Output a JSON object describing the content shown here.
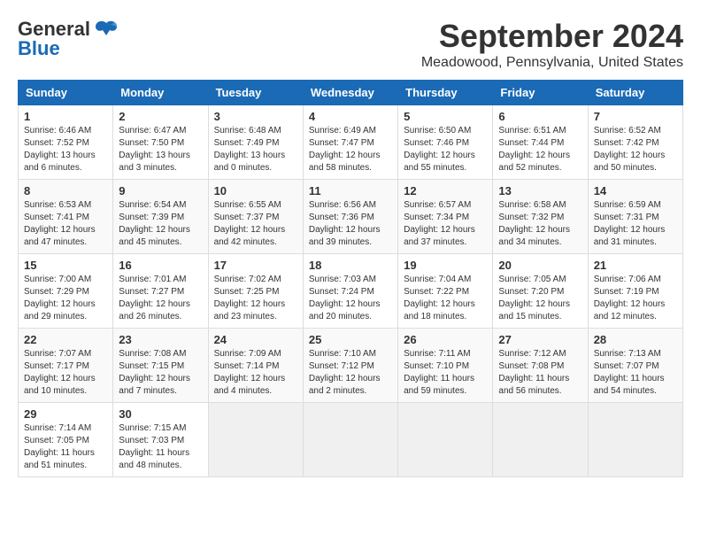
{
  "header": {
    "logo_general": "General",
    "logo_blue": "Blue",
    "month_title": "September 2024",
    "location": "Meadowood, Pennsylvania, United States"
  },
  "weekdays": [
    "Sunday",
    "Monday",
    "Tuesday",
    "Wednesday",
    "Thursday",
    "Friday",
    "Saturday"
  ],
  "weeks": [
    [
      {
        "day": "1",
        "sunrise": "6:46 AM",
        "sunset": "7:52 PM",
        "daylight": "13 hours and 6 minutes."
      },
      {
        "day": "2",
        "sunrise": "6:47 AM",
        "sunset": "7:50 PM",
        "daylight": "13 hours and 3 minutes."
      },
      {
        "day": "3",
        "sunrise": "6:48 AM",
        "sunset": "7:49 PM",
        "daylight": "13 hours and 0 minutes."
      },
      {
        "day": "4",
        "sunrise": "6:49 AM",
        "sunset": "7:47 PM",
        "daylight": "12 hours and 58 minutes."
      },
      {
        "day": "5",
        "sunrise": "6:50 AM",
        "sunset": "7:46 PM",
        "daylight": "12 hours and 55 minutes."
      },
      {
        "day": "6",
        "sunrise": "6:51 AM",
        "sunset": "7:44 PM",
        "daylight": "12 hours and 52 minutes."
      },
      {
        "day": "7",
        "sunrise": "6:52 AM",
        "sunset": "7:42 PM",
        "daylight": "12 hours and 50 minutes."
      }
    ],
    [
      {
        "day": "8",
        "sunrise": "6:53 AM",
        "sunset": "7:41 PM",
        "daylight": "12 hours and 47 minutes."
      },
      {
        "day": "9",
        "sunrise": "6:54 AM",
        "sunset": "7:39 PM",
        "daylight": "12 hours and 45 minutes."
      },
      {
        "day": "10",
        "sunrise": "6:55 AM",
        "sunset": "7:37 PM",
        "daylight": "12 hours and 42 minutes."
      },
      {
        "day": "11",
        "sunrise": "6:56 AM",
        "sunset": "7:36 PM",
        "daylight": "12 hours and 39 minutes."
      },
      {
        "day": "12",
        "sunrise": "6:57 AM",
        "sunset": "7:34 PM",
        "daylight": "12 hours and 37 minutes."
      },
      {
        "day": "13",
        "sunrise": "6:58 AM",
        "sunset": "7:32 PM",
        "daylight": "12 hours and 34 minutes."
      },
      {
        "day": "14",
        "sunrise": "6:59 AM",
        "sunset": "7:31 PM",
        "daylight": "12 hours and 31 minutes."
      }
    ],
    [
      {
        "day": "15",
        "sunrise": "7:00 AM",
        "sunset": "7:29 PM",
        "daylight": "12 hours and 29 minutes."
      },
      {
        "day": "16",
        "sunrise": "7:01 AM",
        "sunset": "7:27 PM",
        "daylight": "12 hours and 26 minutes."
      },
      {
        "day": "17",
        "sunrise": "7:02 AM",
        "sunset": "7:25 PM",
        "daylight": "12 hours and 23 minutes."
      },
      {
        "day": "18",
        "sunrise": "7:03 AM",
        "sunset": "7:24 PM",
        "daylight": "12 hours and 20 minutes."
      },
      {
        "day": "19",
        "sunrise": "7:04 AM",
        "sunset": "7:22 PM",
        "daylight": "12 hours and 18 minutes."
      },
      {
        "day": "20",
        "sunrise": "7:05 AM",
        "sunset": "7:20 PM",
        "daylight": "12 hours and 15 minutes."
      },
      {
        "day": "21",
        "sunrise": "7:06 AM",
        "sunset": "7:19 PM",
        "daylight": "12 hours and 12 minutes."
      }
    ],
    [
      {
        "day": "22",
        "sunrise": "7:07 AM",
        "sunset": "7:17 PM",
        "daylight": "12 hours and 10 minutes."
      },
      {
        "day": "23",
        "sunrise": "7:08 AM",
        "sunset": "7:15 PM",
        "daylight": "12 hours and 7 minutes."
      },
      {
        "day": "24",
        "sunrise": "7:09 AM",
        "sunset": "7:14 PM",
        "daylight": "12 hours and 4 minutes."
      },
      {
        "day": "25",
        "sunrise": "7:10 AM",
        "sunset": "7:12 PM",
        "daylight": "12 hours and 2 minutes."
      },
      {
        "day": "26",
        "sunrise": "7:11 AM",
        "sunset": "7:10 PM",
        "daylight": "11 hours and 59 minutes."
      },
      {
        "day": "27",
        "sunrise": "7:12 AM",
        "sunset": "7:08 PM",
        "daylight": "11 hours and 56 minutes."
      },
      {
        "day": "28",
        "sunrise": "7:13 AM",
        "sunset": "7:07 PM",
        "daylight": "11 hours and 54 minutes."
      }
    ],
    [
      {
        "day": "29",
        "sunrise": "7:14 AM",
        "sunset": "7:05 PM",
        "daylight": "11 hours and 51 minutes."
      },
      {
        "day": "30",
        "sunrise": "7:15 AM",
        "sunset": "7:03 PM",
        "daylight": "11 hours and 48 minutes."
      },
      null,
      null,
      null,
      null,
      null
    ]
  ]
}
